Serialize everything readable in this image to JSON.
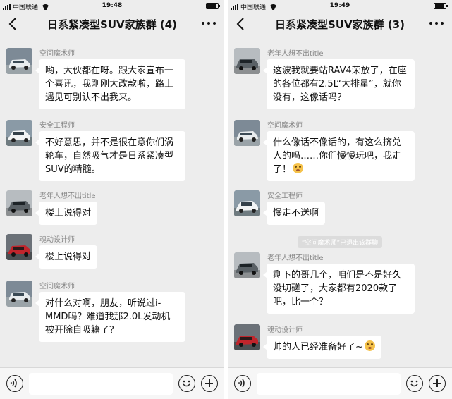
{
  "screens": [
    {
      "status": {
        "carrier": "中国联通",
        "time": "19:48"
      },
      "title": "日系紧凑型SUV家族群 (4)",
      "messages": [
        {
          "sender": "空间魔术师",
          "text": "哟，大伙都在呀。跟大家宣布一个喜讯，我刚刚大改款啦，路上遇见可别认不出我来。",
          "avatar": "white-suv"
        },
        {
          "sender": "安全工程师",
          "text": "不好意思，并不是很在意你们涡轮车，自然吸气才是日系紧凑型SUV的精髓。",
          "avatar": "white-suv-2"
        },
        {
          "sender": "老年人想不出title",
          "text": "楼上说得对",
          "avatar": "silver-suv"
        },
        {
          "sender": "魂动设计师",
          "text": "楼上说得对",
          "avatar": "red-suv"
        },
        {
          "sender": "空间魔术师",
          "text": "对什么对啊，朋友，听说过i-MMD吗？难道我那2.0L发动机被开除自吸籍了？",
          "avatar": "white-suv"
        }
      ]
    },
    {
      "status": {
        "carrier": "中国联通",
        "time": "19:49"
      },
      "title": "日系紧凑型SUV家族群 (3)",
      "messages": [
        {
          "sender": "老年人想不出title",
          "text": "这波我就要站RAV4荣放了，在座的各位都有2.5L“大排量”，就你没有，这像话吗？",
          "avatar": "silver-suv"
        },
        {
          "sender": "空间魔术师",
          "text": "什么像话不像话的，有这么挤兑人的吗……你们慢慢玩吧，我走了！",
          "avatar": "white-suv"
        },
        {
          "sender": "安全工程师",
          "text": "慢走不送啊",
          "avatar": "white-suv-2"
        },
        {
          "sender": "老年人想不出title",
          "text": "剩下的哥几个，咱们是不是好久没切磋了，大家都有2020款了吧，比一个？",
          "avatar": "silver-suv"
        },
        {
          "sender": "魂动设计师",
          "text": "帅的人已经准备好了~",
          "avatar": "red-suv"
        }
      ],
      "system_note": "“空间魔术师”已退出该群聊"
    }
  ]
}
